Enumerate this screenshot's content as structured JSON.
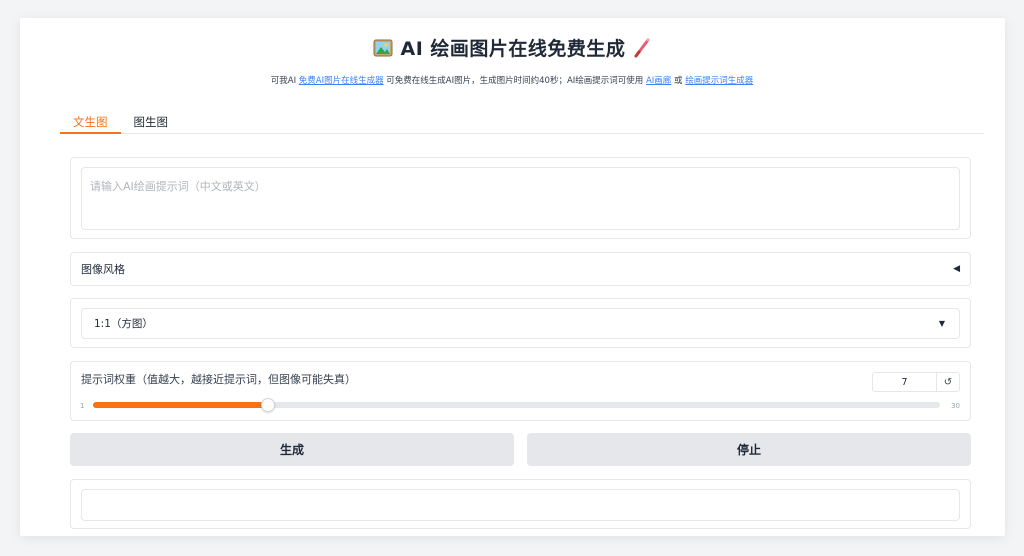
{
  "header": {
    "title": "AI 绘画图片在线免费生成",
    "subtitle_parts": {
      "prefix": "可我AI ",
      "link1": "免费AI图片在线生成器",
      "middle": " 可免费在线生成AI图片，生成图片时间约40秒；AI绘画提示词可使用 ",
      "link2": "AI画廊",
      "or": " 或 ",
      "link3": "绘画提示词生成器"
    }
  },
  "tabs": [
    {
      "label": "文生图",
      "active": true
    },
    {
      "label": "图生图",
      "active": false
    }
  ],
  "prompt": {
    "placeholder": "请输入AI绘画提示词（中文或英文）",
    "value": ""
  },
  "style": {
    "label": "图像风格",
    "toggle_icon": "triangle-left-icon"
  },
  "ratio": {
    "selected": "1:1（方图）"
  },
  "weight": {
    "label": "提示词权重（值越大，越接近提示词，但图像可能失真）",
    "value": "7",
    "value_number": 7,
    "min": "1",
    "max": "30",
    "min_number": 1,
    "max_number": 30
  },
  "buttons": {
    "generate": "生成",
    "stop": "停止"
  },
  "colors": {
    "accent": "#f97316",
    "link": "#3b82f6",
    "button_bg": "#e5e7eb"
  }
}
